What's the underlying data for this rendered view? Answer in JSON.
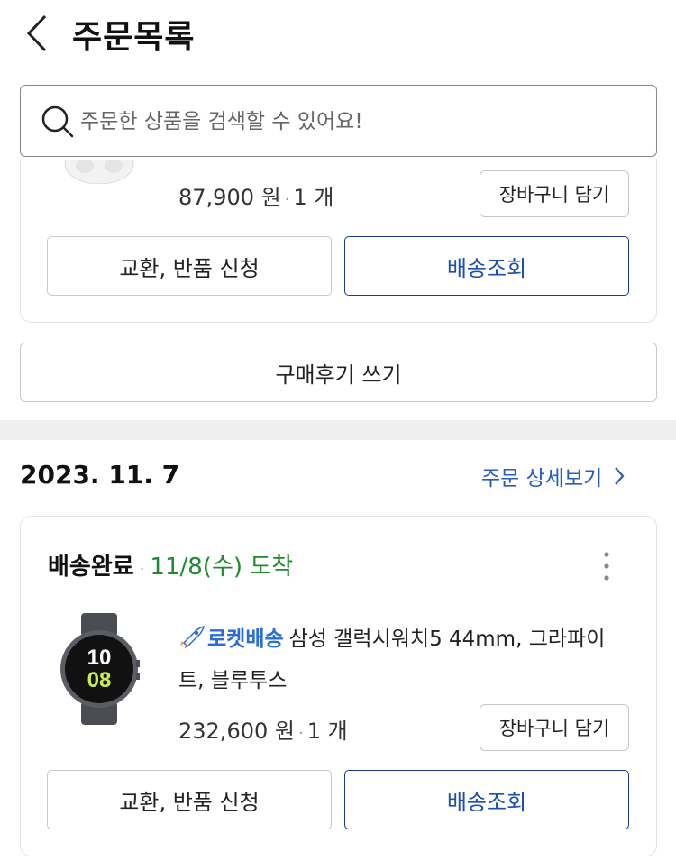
{
  "header": {
    "title": "주문목록"
  },
  "search": {
    "placeholder": "주문한 상품을 검색할 수 있어요!"
  },
  "prev_order": {
    "price": "87,900 원",
    "quantity": "1 개",
    "cart_button": "장바구니 담기",
    "exchange_button": "교환, 반품 신청",
    "tracking_button": "배송조회",
    "review_button": "구매후기 쓰기"
  },
  "order": {
    "date": "2023. 11. 7",
    "detail_link": "주문 상세보기",
    "status": "배송완료",
    "arrival": "11/8(수) 도착",
    "badge": "로켓배송",
    "product_name": "삼성 갤럭시워치5 44mm, 그라파이트, 블루투스",
    "price": "232,600 원",
    "quantity": "1 개",
    "cart_button": "장바구니 담기",
    "exchange_button": "교환, 반품 신청",
    "tracking_button": "배송조회",
    "watch_time_hour": "10",
    "watch_time_min": "08"
  },
  "colors": {
    "accent_blue": "#1c4fb0",
    "arrival_green": "#1f8a2e",
    "rocket_blue": "#2a6cd9"
  },
  "icons": [
    "back-arrow-icon",
    "search-icon",
    "chevron-right-icon",
    "more-vertical-icon",
    "rocket-icon"
  ]
}
